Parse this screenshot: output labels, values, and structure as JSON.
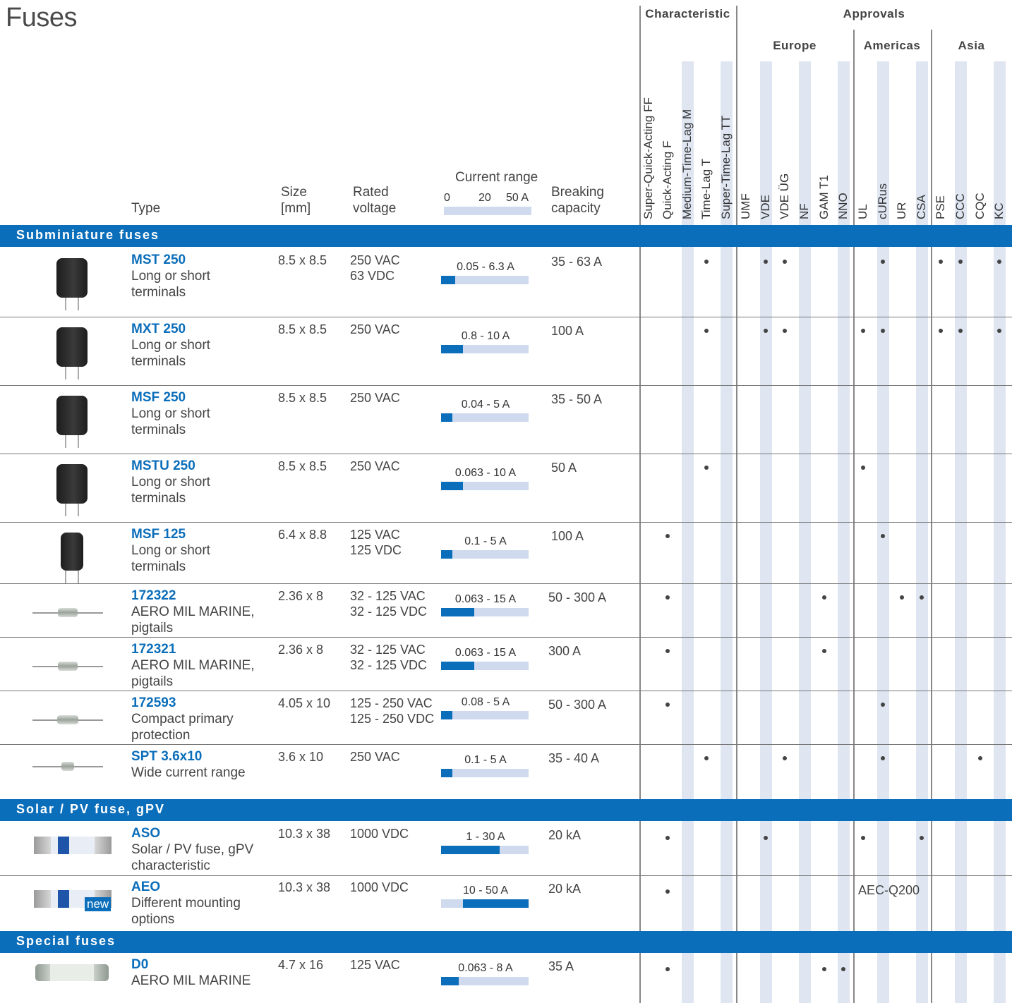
{
  "title": "Fuses",
  "headers": {
    "type": "Type",
    "size_1": "Size",
    "size_2": "[mm]",
    "voltage_1": "Rated",
    "voltage_2": "voltage",
    "current": "Current range",
    "scale_0": "0",
    "scale_20": "20",
    "scale_50": "50 A",
    "breaking_1": "Breaking",
    "breaking_2": "capacity"
  },
  "groups": {
    "characteristic": "Characteristic",
    "approvals": "Approvals",
    "europe": "Europe",
    "americas": "Americas",
    "asia": "Asia"
  },
  "columns": [
    "Super-Quick-Acting FF",
    "Quick-Acting F",
    "Medium-Time-Lag M",
    "Time-Lag T",
    "Super-Time-Lag TT",
    "UMF",
    "VDE",
    "VDE ÜG",
    "NF",
    "GAM T1",
    "NNO",
    "UL",
    "cURus",
    "UR",
    "CSA",
    "PSE",
    "CCC",
    "CQC",
    "KC"
  ],
  "sections": {
    "subminiature": "Subminiature fuses",
    "solar": "Solar / PV fuse, gPV",
    "special": "Special fuses"
  },
  "products": [
    {
      "name": "MST 250",
      "desc": [
        "Long or short",
        "terminals"
      ],
      "size": "8.5 x 8.5",
      "voltage": [
        "250 VAC",
        "63 VDC"
      ],
      "range": "0.05 - 6.3 A",
      "range_max_a": 6.3,
      "breaking": "35 - 63 A",
      "marks": [
        "Time-Lag T",
        "VDE",
        "VDE ÜG",
        "cURus",
        "PSE",
        "CCC",
        "KC"
      ]
    },
    {
      "name": "MXT 250",
      "desc": [
        "Long or short",
        "terminals"
      ],
      "size": "8.5 x 8.5",
      "voltage": [
        "250 VAC"
      ],
      "range": "0.8 - 10 A",
      "range_max_a": 10,
      "breaking": "100 A",
      "marks": [
        "Time-Lag T",
        "VDE",
        "VDE ÜG",
        "UL",
        "cURus",
        "PSE",
        "CCC",
        "KC"
      ]
    },
    {
      "name": "MSF 250",
      "desc": [
        "Long or short",
        "terminals"
      ],
      "size": "8.5 x 8.5",
      "voltage": [
        "250 VAC"
      ],
      "range": "0.04 - 5 A",
      "range_max_a": 5,
      "breaking": "35 - 50 A",
      "marks": []
    },
    {
      "name": "MSTU 250",
      "desc": [
        "Long or short",
        "terminals"
      ],
      "size": "8.5 x 8.5",
      "voltage": [
        "250 VAC"
      ],
      "range": "0.063 - 10 A",
      "range_max_a": 10,
      "breaking": "50 A",
      "marks": [
        "Time-Lag T",
        "UL"
      ]
    },
    {
      "name": "MSF 125",
      "desc": [
        "Long or short",
        "terminals"
      ],
      "size": "6.4 x 8.8",
      "voltage": [
        "125 VAC",
        "125 VDC"
      ],
      "range": "0.1 - 5 A",
      "range_max_a": 5,
      "breaking": "100 A",
      "marks": [
        "Quick-Acting F",
        "cURus"
      ]
    },
    {
      "name": "172322",
      "desc": [
        "AERO MIL MARINE,",
        "pigtails"
      ],
      "size": "2.36 x 8",
      "voltage": [
        "32 - 125 VAC",
        "32 - 125 VDC"
      ],
      "range": "0.063 - 15 A",
      "range_max_a": 15,
      "breaking": "50 - 300 A",
      "marks": [
        "Quick-Acting F",
        "GAM T1",
        "UR",
        "CSA"
      ]
    },
    {
      "name": "172321",
      "desc": [
        "AERO MIL MARINE,",
        "pigtails"
      ],
      "size": "2.36 x 8",
      "voltage": [
        "32 - 125 VAC",
        "32 - 125 VDC"
      ],
      "range": "0.063 - 15 A",
      "range_max_a": 15,
      "breaking": "300 A",
      "marks": [
        "Quick-Acting F",
        "GAM T1"
      ]
    },
    {
      "name": "172593",
      "desc": [
        "Compact primary",
        "protection"
      ],
      "size": "4.05 x 10",
      "voltage": [
        "125 - 250 VAC",
        "125 - 250 VDC"
      ],
      "range": "0.08 - 5 A",
      "range_max_a": 5,
      "breaking": "50 - 300 A",
      "marks": [
        "Quick-Acting F",
        "cURus"
      ]
    },
    {
      "name": "SPT 3.6x10",
      "desc": [
        "Wide current range"
      ],
      "size": "3.6 x 10",
      "voltage": [
        "250 VAC"
      ],
      "range": "0.1 - 5 A",
      "range_max_a": 5,
      "breaking": "35 - 40 A",
      "marks": [
        "Time-Lag T",
        "VDE ÜG",
        "cURus",
        "CQC"
      ]
    },
    {
      "name": "ASO",
      "desc": [
        "Solar / PV fuse, gPV",
        "characteristic"
      ],
      "size": "10.3 x 38",
      "voltage": [
        "1000 VDC"
      ],
      "range": "1 - 30 A",
      "range_max_a": 30,
      "breaking": "20 kA",
      "marks": [
        "Quick-Acting F",
        "VDE",
        "UL",
        "CSA"
      ]
    },
    {
      "name": "AEO",
      "desc": [
        "Different mounting",
        "options"
      ],
      "size": "10.3 x 38",
      "voltage": [
        "1000 VDC"
      ],
      "range": "10 - 50 A",
      "range_min_a": 10,
      "range_max_a": 50,
      "breaking": "20 kA",
      "marks": [
        "Quick-Acting F"
      ],
      "note": "AEC-Q200",
      "badge": "new"
    },
    {
      "name": "D0",
      "desc": [
        "AERO MIL MARINE"
      ],
      "size": "4.7 x 16",
      "voltage": [
        "125 VAC"
      ],
      "range": "0.063 - 8 A",
      "range_max_a": 8,
      "breaking": "35 A",
      "marks": [
        "Quick-Acting F",
        "GAM T1",
        "NNO"
      ]
    }
  ],
  "colors": {
    "accent": "#0b6eba",
    "band": "#dfe6f2",
    "track": "#cfdaef"
  }
}
